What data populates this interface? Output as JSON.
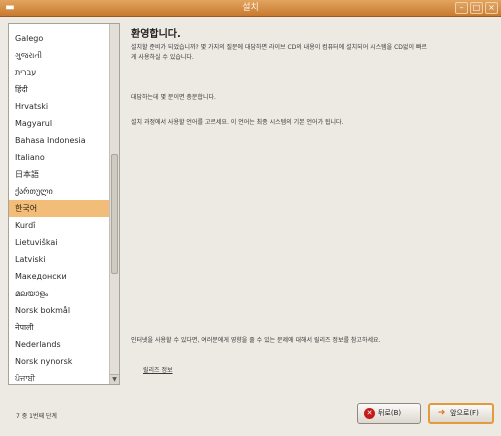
{
  "window": {
    "title": "설치"
  },
  "language_list": {
    "items": [
      "Galego",
      "ગુજરાતી",
      "עברית",
      "हिंदी",
      "Hrvatski",
      "Magyarul",
      "Bahasa Indonesia",
      "Italiano",
      "日本語",
      "ქართული",
      "한국어",
      "Kurdî",
      "Lietuviškai",
      "Latviski",
      "Македонски",
      "മലയാളം",
      "Norsk bokmål",
      "नेपाली",
      "Nederlands",
      "Norsk nynorsk",
      "ਪੰਜਾਬੀ"
    ],
    "selected_index": 10
  },
  "main": {
    "heading": "환영합니다.",
    "paragraph1": "설치할 준비가 되었습니까? 몇 가지의 질문에 대답하면 라이브 CD의 내용이 컴퓨터에 설치되어 시스템을 CD없이 빠르게 사용하실 수 있습니다.",
    "paragraph2": "대답하는데 몇 분이면 충분합니다.",
    "paragraph3": "설치 과정에서 사용할 언어를 고르세요. 이 언어는 최종 시스템의 기본 언어가 됩니다.",
    "paragraph4": "인터넷을 사용할 수 있다면, 여러분에게 영향을 줄 수 있는 문제에 대해서 릴리즈 정보를 참고하세요.",
    "release_notes_link": "릴리즈 정보"
  },
  "footer": {
    "step_text": "7 중 1번째 단계",
    "back_label": "뒤로(B)",
    "forward_label": "앞으로(F)"
  }
}
